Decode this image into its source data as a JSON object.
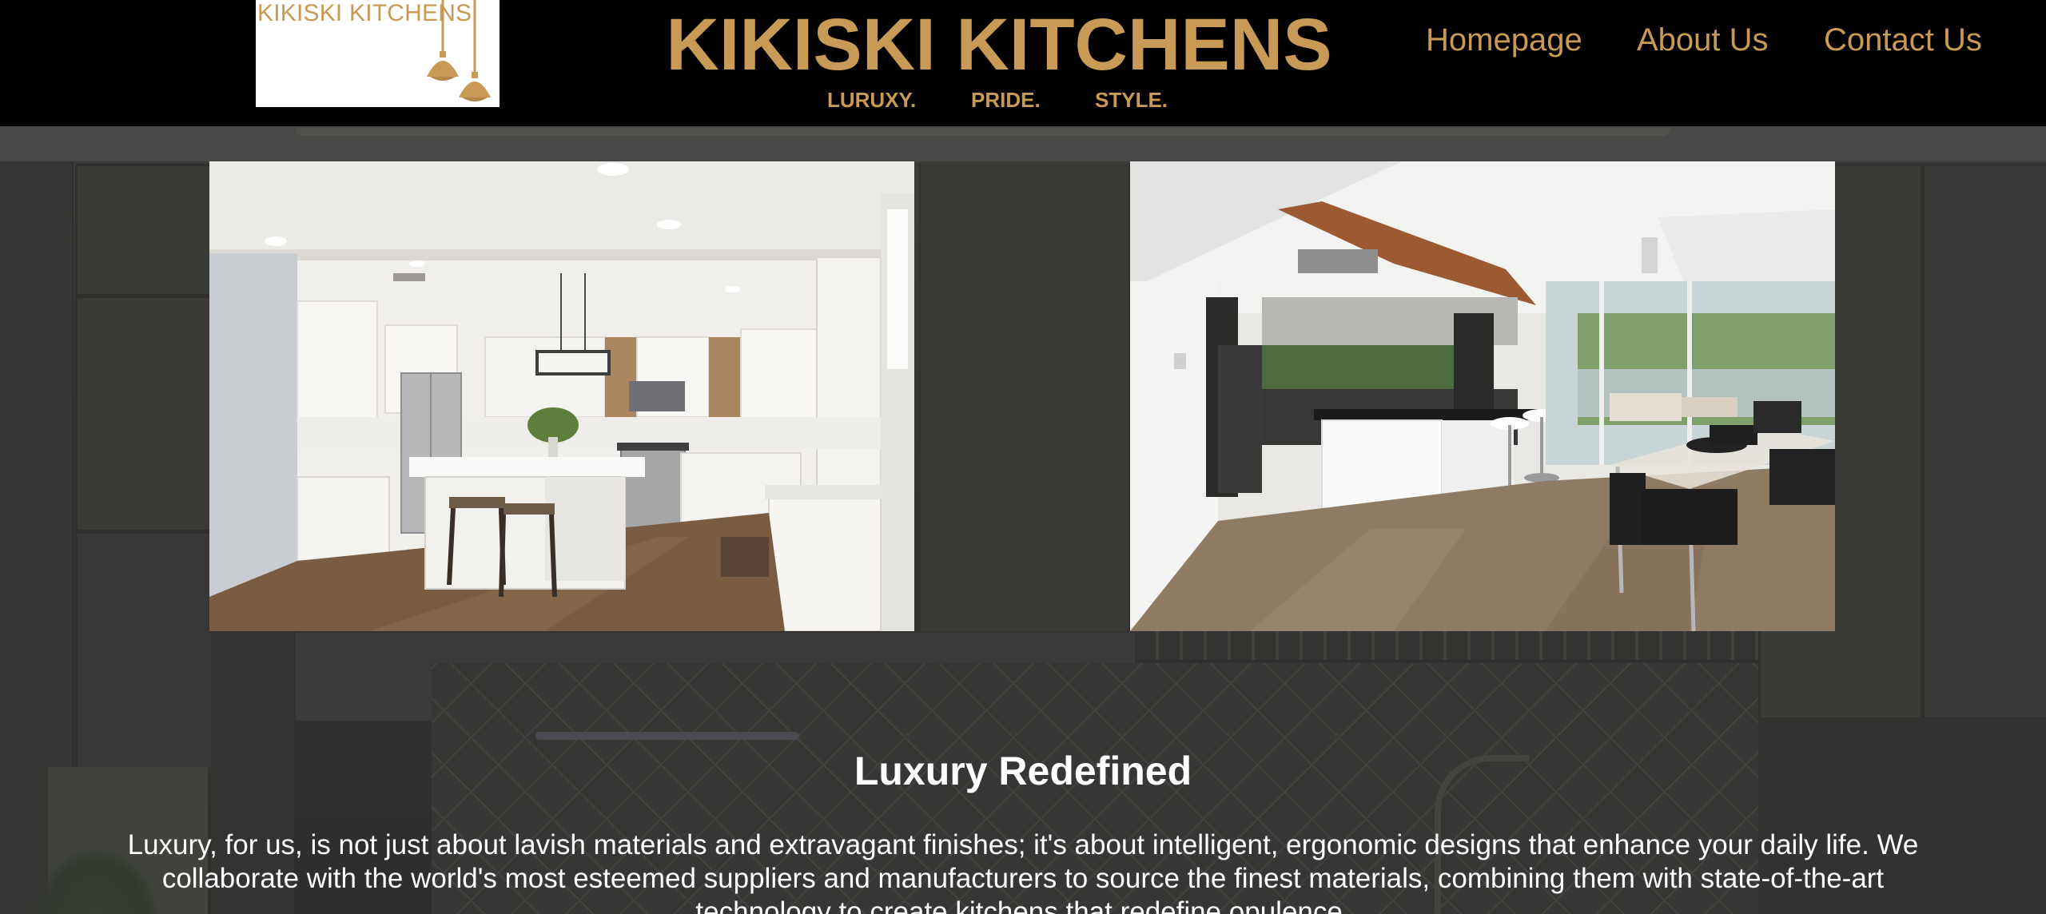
{
  "header": {
    "logo_text": "KIKISKI KITCHENS",
    "brand_title": "KIKISKI KITCHENS",
    "taglines": [
      "LURUXY.",
      "PRIDE.",
      "STYLE."
    ]
  },
  "nav": {
    "items": [
      {
        "label": "Homepage"
      },
      {
        "label": "About Us"
      },
      {
        "label": "Contact Us"
      }
    ]
  },
  "main": {
    "title": "Luxury Redefined",
    "body": "Luxury, for us, is not just about lavish materials and extravagant finishes; it's about intelligent, ergonomic designs that enhance your daily life. We collaborate with the world's most esteemed suppliers and manufacturers to source the finest materials, combining them with state-of-the-art technology to create kitchens that redefine opulence."
  },
  "colors": {
    "header_background": "#000000",
    "brand_gold": "#c99a55",
    "body_text": "#ffffff"
  },
  "icons": {
    "logo": "pendant-lamps-logo"
  }
}
